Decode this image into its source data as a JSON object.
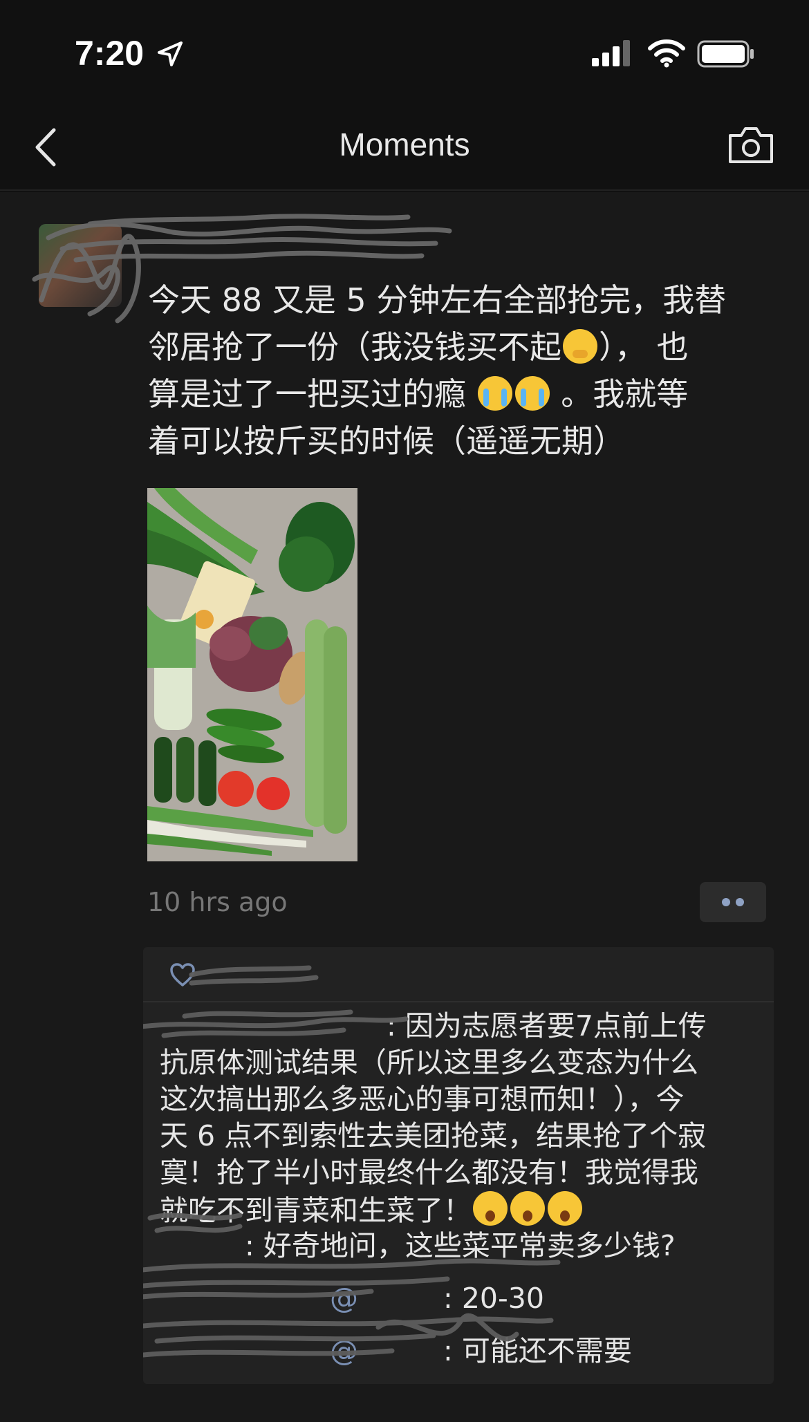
{
  "status_bar": {
    "time": "7:20"
  },
  "nav": {
    "title": "Moments"
  },
  "post": {
    "text_lines": [
      "今天 88 又是 5 分钟左右全部抢完，我替",
      "邻居抢了一份（我没钱买不起",
      "）， 也",
      "算是过了一把买过的瘾 ",
      " 。我就等",
      "着可以按斤买的时候（遥遥无期）"
    ],
    "timestamp": "10 hrs ago",
    "image_alt": "vegetables"
  },
  "comments": [
    {
      "text_lines": [
        ": 因为志愿者要7点前上传",
        "抗原体测试结果（所以这里多么变态为什么",
        "这次搞出那么多恶心的事可想而知！），今",
        "天 6 点不到索性去美团抢菜，结果抢了个寂",
        "寞！抢了半小时最终什么都没有！我觉得我",
        "就吃不到青菜和生菜了！"
      ]
    },
    {
      "text": ": 好奇地问，这些菜平常卖多少钱?"
    },
    {
      "mention": "@",
      "text": ": 20-30"
    },
    {
      "mention": "@",
      "text": ": 可能还不需要"
    }
  ],
  "icons": {
    "back": "chevron-left-icon",
    "camera": "camera-icon",
    "like": "heart-outline-icon"
  },
  "colors": {
    "background": "#191919",
    "link_name": "#7a8fb3",
    "timestamp": "#777777"
  }
}
